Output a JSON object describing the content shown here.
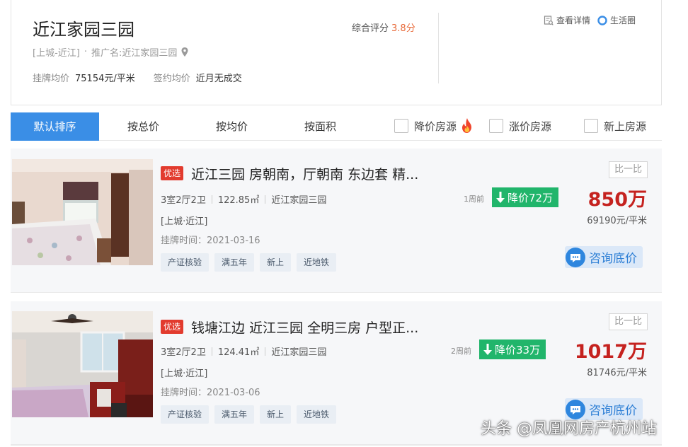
{
  "header": {
    "community_name": "近江家园三园",
    "location": "[上城-近江]",
    "promo_prefix": "推广名:",
    "promo_name": "近江家园三园",
    "listing_avg_label": "挂牌均价",
    "listing_avg_value": "75154元/平米",
    "signed_avg_label": "签约均价",
    "signed_avg_value": "近月无成交",
    "rating_label": "综合评分",
    "rating_value": "3.8分",
    "detail_link": "查看详情",
    "life_link": "生活圈"
  },
  "sort_bar": {
    "tabs": [
      "默认排序",
      "按总价",
      "按均价",
      "按面积"
    ],
    "filters": [
      "降价房源",
      "涨价房源",
      "新上房源"
    ]
  },
  "listings": [
    {
      "badge": "优选",
      "title": "近江三园 房朝南，厅朝南 东边套 精...",
      "layout": "3室2厅2卫",
      "area": "122.85㎡",
      "community": "近江家园三园",
      "district": "[上城·近江]",
      "listed_time": "挂牌时间：2021-03-16",
      "tags": [
        "产证核验",
        "满五年",
        "新上",
        "近地铁"
      ],
      "weeks_ago": "1周前",
      "price_drop": "降价72万",
      "total_price": "850万",
      "unit_price": "69190元/平米",
      "compare": "比一比",
      "consult": "咨询底价"
    },
    {
      "badge": "优选",
      "title": "钱塘江边 近江三园 全明三房 户型正...",
      "layout": "3室2厅2卫",
      "area": "124.41㎡",
      "community": "近江家园三园",
      "district": "[上城·近江]",
      "listed_time": "挂牌时间：2021-03-06",
      "tags": [
        "产证核验",
        "满五年",
        "新上",
        "近地铁"
      ],
      "weeks_ago": "2周前",
      "price_drop": "降价33万",
      "total_price": "1017万",
      "unit_price": "81746元/平米",
      "compare": "比一比",
      "consult": "咨询底价"
    }
  ],
  "watermark": "头条 @凤凰网房产杭州站",
  "colors": {
    "accent_blue": "#3a8ee6",
    "price_red": "#c5221f",
    "drop_green": "#21b56b",
    "badge_red": "#e23b2e",
    "rating_orange": "#e86a3a"
  },
  "icons": [
    "location-pin-icon",
    "detail-doc-icon",
    "life-circle-icon",
    "fire-icon",
    "down-arrow-icon",
    "chat-bubble-icon"
  ]
}
